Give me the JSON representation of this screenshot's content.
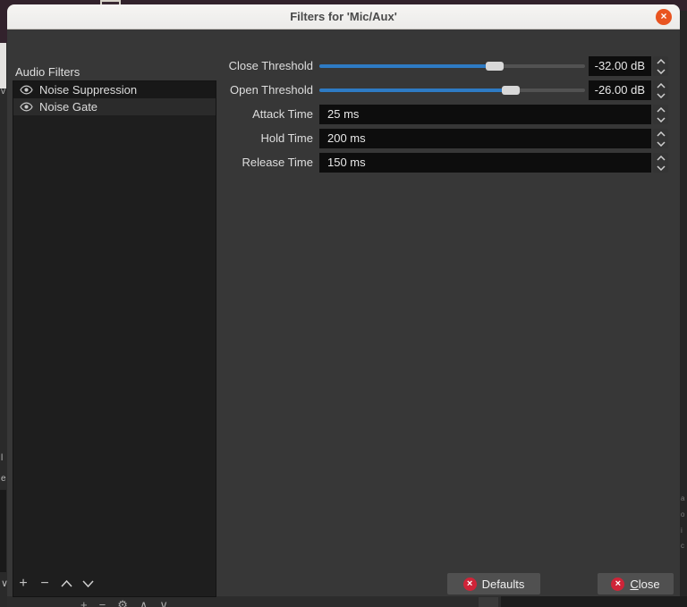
{
  "window": {
    "title": "Filters for 'Mic/Aux'",
    "close_glyph": "×"
  },
  "left_panel": {
    "header": "Audio Filters",
    "filters": [
      {
        "label": "Noise Suppression",
        "selected": false
      },
      {
        "label": "Noise Gate",
        "selected": true
      }
    ],
    "toolbar": {
      "add": "+",
      "remove": "−"
    }
  },
  "properties": {
    "close_threshold": {
      "label": "Close Threshold",
      "value": "-32.00 dB",
      "fill_pct": 66
    },
    "open_threshold": {
      "label": "Open Threshold",
      "value": "-26.00 dB",
      "fill_pct": 72
    },
    "attack_time": {
      "label": "Attack Time",
      "value": "25 ms"
    },
    "hold_time": {
      "label": "Hold Time",
      "value": "200 ms"
    },
    "release_time": {
      "label": "Release Time",
      "value": "150 ms"
    }
  },
  "footer": {
    "defaults_label": "Defaults",
    "close_label": "Close"
  },
  "background": {
    "bottom_icons": [
      "+",
      "−",
      "⚙",
      "∧",
      "∨"
    ],
    "left_edge_glyphs": {
      "g1": "v",
      "g2": "l",
      "g3": "e",
      "g4": "∨"
    },
    "right_edge_glyphs": {
      "g1": "a",
      "g2": "o",
      "g3": "i",
      "g4": "c"
    }
  },
  "colors": {
    "accent_blue": "#2e7bc4",
    "titlebar_close_orange": "#e95420",
    "button_icon_red": "#cf2438",
    "dialog_bg": "#373737",
    "list_bg": "#1e1e1e",
    "field_bg": "#0d0d0d",
    "titlebar_bg": "#f1efed"
  }
}
